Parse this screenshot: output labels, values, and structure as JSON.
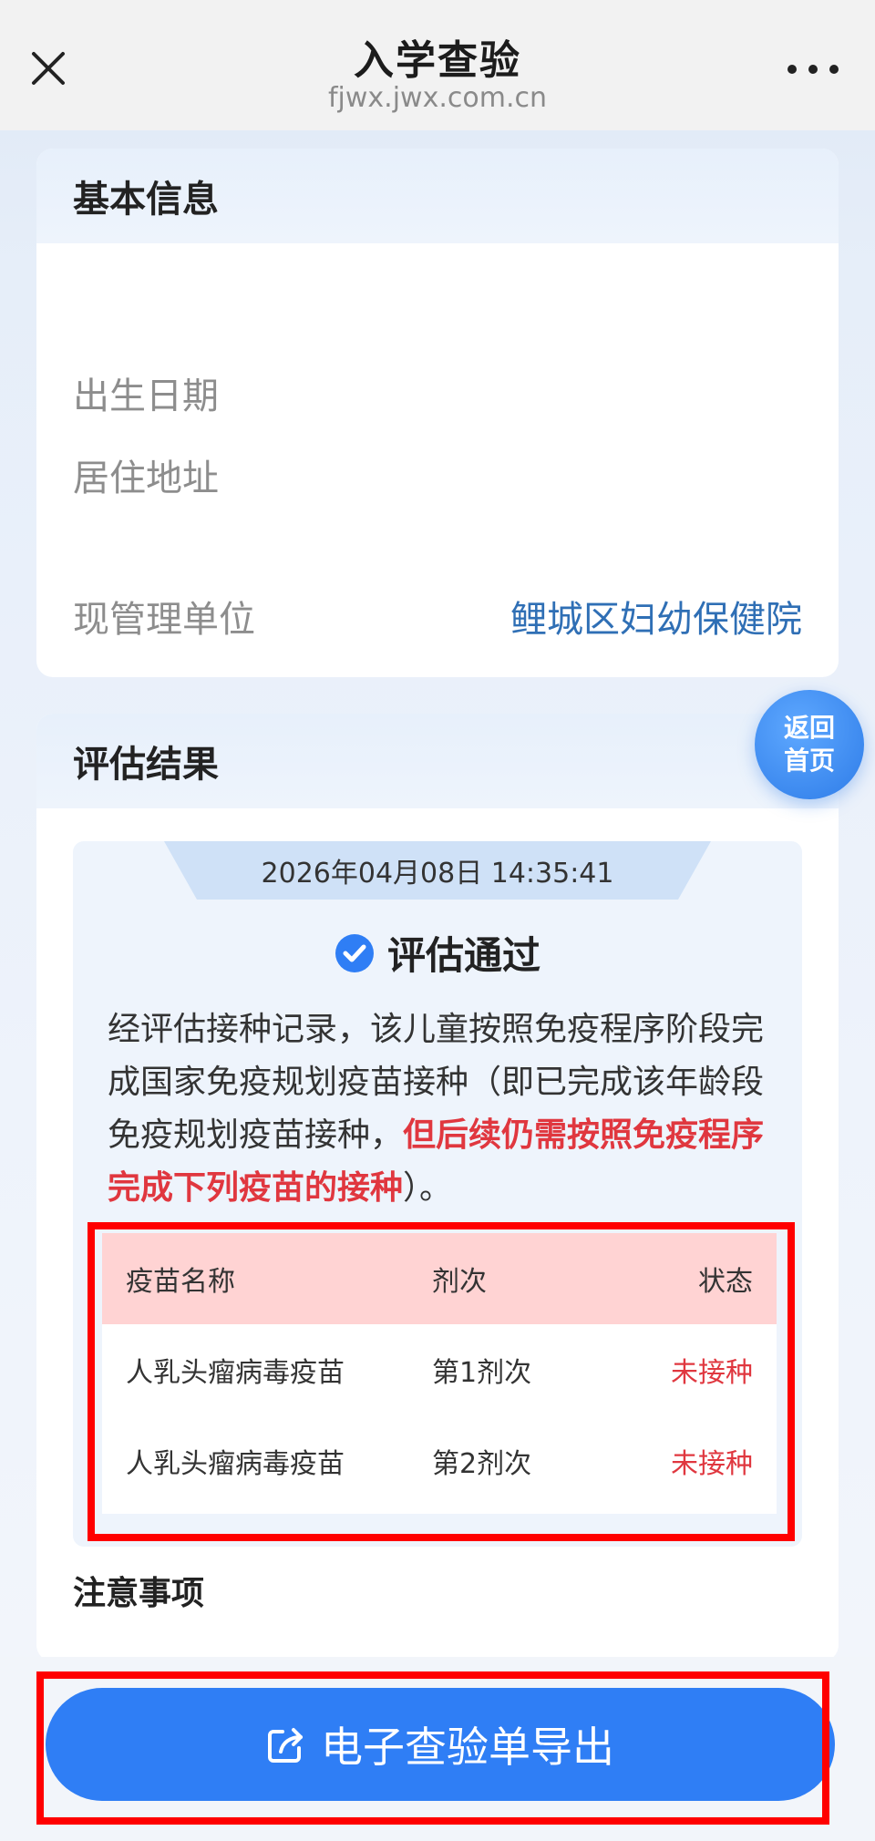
{
  "header": {
    "title": "入学查验",
    "domain": "fjwx.jwx.com.cn"
  },
  "basic_info": {
    "section_title": "基本信息",
    "rows": [
      {
        "label": "出生日期",
        "value": ""
      },
      {
        "label": "居住地址",
        "value": ""
      },
      {
        "label": "现管理单位",
        "value": "鲤城区妇幼保健院"
      }
    ]
  },
  "assessment": {
    "section_title": "评估结果",
    "timestamp": "2026年04月08日 14:35:41",
    "status": "评估通过",
    "description_normal_1": "经评估接种记录，该儿童按照免疫程序阶段完成国家免疫规划疫苗接种（即已完成该年龄段免疫规划疫苗接种，",
    "description_warning": "但后续仍需按照免疫程序完成下列疫苗的接种",
    "description_normal_2": "）。",
    "table": {
      "headers": [
        "疫苗名称",
        "剂次",
        "状态"
      ],
      "rows": [
        [
          "人乳头瘤病毒疫苗",
          "第1剂次",
          "未接种"
        ],
        [
          "人乳头瘤病毒疫苗",
          "第2剂次",
          "未接种"
        ]
      ]
    },
    "notes_title": "注意事项"
  },
  "home_button": {
    "line1": "返回",
    "line2": "首页"
  },
  "export_button": {
    "label": "电子查验单导出"
  },
  "colors": {
    "primary": "#2f7ef5",
    "link": "#2f6fb5",
    "warning": "#e0373f",
    "table_header_bg": "#ffd3d3",
    "highlight_border": "#ff0000"
  }
}
